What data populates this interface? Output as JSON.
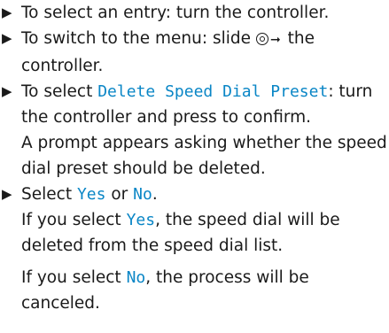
{
  "steps": [
    {
      "text": "To select an entry: turn the controller."
    },
    {
      "before": "To switch to the menu: slide",
      "after": "the controller."
    },
    {
      "before": "To select ",
      "highlight": "Delete Speed Dial Preset",
      "after": ": turn the controller and press to confirm.",
      "note": "A prompt appears asking whether the speed dial preset should be deleted."
    },
    {
      "before": "Select ",
      "yes": "Yes",
      "or": " or ",
      "no": "No",
      "end": ".",
      "yes_line_before": "If you select ",
      "yes_line_after": ", the speed dial will be deleted from the speed dial list.",
      "no_line_before": "If you select ",
      "no_line_after": ", the process will be canceled."
    }
  ],
  "icons": {
    "bullet": "triangle-right-icon",
    "controller": "controller-slide-icon",
    "arrow": "arrow-right-icon"
  },
  "colors": {
    "text": "#1a1a1a",
    "highlight": "#0a86c6"
  }
}
